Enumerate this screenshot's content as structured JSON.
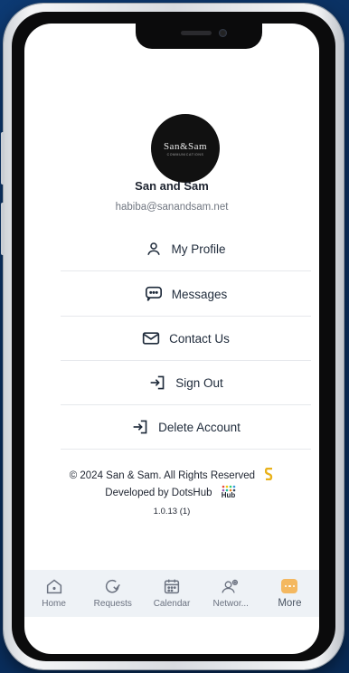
{
  "profile": {
    "logo_text": "San&Sam",
    "logo_subtext": "COMMUNICATIONS",
    "name": "San and Sam",
    "email": "habiba@sanandsam.net"
  },
  "menu": [
    {
      "label": "My Profile",
      "icon": "user-icon"
    },
    {
      "label": "Messages",
      "icon": "chat-icon"
    },
    {
      "label": "Contact Us",
      "icon": "mail-icon"
    },
    {
      "label": "Sign Out",
      "icon": "sign-out-icon"
    },
    {
      "label": "Delete Account",
      "icon": "delete-account-icon"
    }
  ],
  "footer": {
    "copyright": "© 2024 San & Sam. All Rights Reserved",
    "developed_by": "Developed by DotsHub",
    "dotshub_logo_text": "Hub",
    "version": "1.0.13 (1)"
  },
  "tabs": [
    {
      "label": "Home",
      "icon": "home-icon"
    },
    {
      "label": "Requests",
      "icon": "requests-icon"
    },
    {
      "label": "Calendar",
      "icon": "calendar-icon"
    },
    {
      "label": "Networ...",
      "icon": "network-icon"
    },
    {
      "label": "More",
      "icon": "more-icon",
      "active": true
    }
  ],
  "colors": {
    "background": "#0a2f5f",
    "text": "#1e2a3a",
    "more_accent": "#f4b860"
  }
}
